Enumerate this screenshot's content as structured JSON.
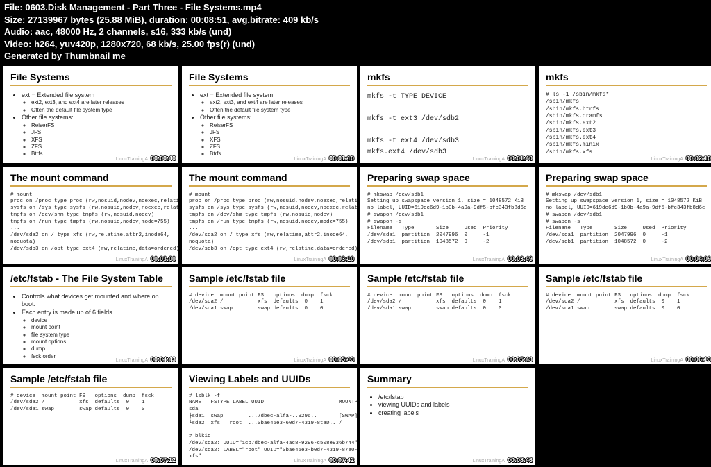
{
  "header": {
    "l1a": "File: ",
    "l1b": "0603.Disk Management - Part Three - File Systems.mp4",
    "l2": "Size: 27139967 bytes (25.88 MiB), duration: 00:08:51, avg.bitrate: 409 kb/s",
    "l3": "Audio: aac, 48000 Hz, 2 channels, s16, 333 kb/s (und)",
    "l4": "Video: h264, yuv420p, 1280x720, 68 kb/s, 25.00 fps(r) (und)",
    "l5": "Generated by Thumbnail me"
  },
  "brand": "LinuxTrainingA",
  "slides": [
    {
      "title": "File Systems",
      "ts": "00:00:40",
      "bullets": [
        {
          "text": "ext = Extended file system",
          "sub": [
            "ext2, ext3, and ext4 are later releases",
            "Often the default file system type"
          ]
        },
        {
          "text": "Other file systems:",
          "sub": [
            "ReiserFS",
            "JFS",
            "XFS",
            "ZFS",
            "Btrfs"
          ]
        }
      ]
    },
    {
      "title": "File Systems",
      "ts": "00:01:10",
      "bullets": [
        {
          "text": "ext = Extended file system",
          "sub": [
            "ext2, ext3, and ext4 are later releases",
            "Often the default file system type"
          ]
        },
        {
          "text": "Other file systems:",
          "sub": [
            "ReiserFS",
            "JFS",
            "XFS",
            "ZFS",
            "Btrfs"
          ]
        }
      ]
    },
    {
      "title": "mkfs",
      "ts": "00:01:40",
      "codeClass": "big",
      "code": "mkfs -t TYPE DEVICE\n\nmkfs -t ext3 /dev/sdb2\n\nmkfs -t ext4 /dev/sdb3\nmkfs.ext4 /dev/sdb3"
    },
    {
      "title": "mkfs",
      "ts": "00:02:10",
      "codeClass": "med",
      "code": "# ls -1 /sbin/mkfs*\n/sbin/mkfs\n/sbin/mkfs.btrfs\n/sbin/mkfs.cramfs\n/sbin/mkfs.ext2\n/sbin/mkfs.ext3\n/sbin/mkfs.ext4\n/sbin/mkfs.minix\n/sbin/mkfs.xfs"
    },
    {
      "title": "The mount command",
      "ts": "00:03:00",
      "code": "# mount\nproc on /proc type proc (rw,nosuid,nodev,noexec,relatime)\nsysfs on /sys type sysfs (rw,nosuid,nodev,noexec,relatime)\ntmpfs on /dev/shm type tmpfs (rw,nosuid,nodev)\ntmpfs on /run type tmpfs (rw,nosuid,nodev,mode=755)\n...\n/dev/sda2 on / type xfs (rw,relatime,attr2,inode64,\nnoquota)\n/dev/sdb3 on /opt type ext4 (rw,relatime,data=ordered)"
    },
    {
      "title": "The mount command",
      "ts": "00:03:10",
      "code": "# mount\nproc on /proc type proc (rw,nosuid,nodev,noexec,relatime)\nsysfs on /sys type sysfs (rw,nosuid,nodev,noexec,relatime)\ntmpfs on /dev/shm type tmpfs (rw,nosuid,nodev)\ntmpfs on /run type tmpfs (rw,nosuid,nodev,mode=755)\n...\n/dev/sda2 on / type xfs (rw,relatime,attr2,inode64,\nnoquota)\n/dev/sdb3 on /opt type ext4 (rw,relatime,data=ordered)"
    },
    {
      "title": "Preparing swap space",
      "ts": "00:03:49",
      "code": "# mkswap /dev/sdb1\nSetting up swapspace version 1, size = 1048572 KiB\nno label, UUID=619dc6d9-1b0b-4a9a-9df5-bfc343fb8d6e\n# swapon /dev/sdb1\n# swapon -s\nFilename   Type       Size     Used  Priority\n/dev/sda1  partition  2047996  0     -1\n/dev/sdb1  partition  1048572  0     -2"
    },
    {
      "title": "Preparing swap space",
      "ts": "00:04:09",
      "code": "# mkswap /dev/sdb1\nSetting up swapspace version 1, size = 1048572 KiB\nno label, UUID=619dc6d9-1b0b-4a9a-9df5-bfc343fb8d6e\n# swapon /dev/sdb1\n# swapon -s\nFilename   Type       Size     Used  Priority\n/dev/sda1  partition  2047996  0     -1\n/dev/sdb1  partition  1048572  0     -2"
    },
    {
      "title": "/etc/fstab - The File System Table",
      "ts": "00:04:43",
      "bullets": [
        {
          "text": "Controls what devices get mounted and where on boot."
        },
        {
          "text": "Each entry is made up of 6 fields",
          "sub": [
            "device",
            "mount point",
            "file system type",
            "mount options",
            "dump",
            "fsck order"
          ]
        }
      ]
    },
    {
      "title": "Sample /etc/fstab file",
      "ts": "00:05:13",
      "code": "# device  mount point FS   options  dump  fsck\n/dev/sda2 /           xfs  defaults  0    1\n/dev/sda1 swap        swap defaults  0    0"
    },
    {
      "title": "Sample /etc/fstab file",
      "ts": "00:05:43",
      "code": "# device  mount point FS   options  dump  fsck\n/dev/sda2 /           xfs  defaults  0    1\n/dev/sda1 swap        swap defaults  0    0"
    },
    {
      "title": "Sample /etc/fstab file",
      "ts": "00:06:13",
      "code": "# device  mount point FS   options  dump  fsck\n/dev/sda2 /           xfs  defaults  0    1\n/dev/sda1 swap        swap defaults  0    0"
    },
    {
      "title": "Sample /etc/fstab file",
      "ts": "00:07:12",
      "code": "# device  mount point FS   options  dump  fsck\n/dev/sda2 /           xfs  defaults  0    1\n/dev/sda1 swap        swap defaults  0    0"
    },
    {
      "title": "Viewing Labels and UUIDs",
      "ts": "00:07:42",
      "code": "# lsblk -f\nNAME   FSTYPE LABEL UUID                        MOUNTPOINT\nsda\n├sda1  swap        ...7dbec-alfa-..9296..       [SWAP]\n└sda2  xfs   root  ...0bae45e3-60d7-4319-8taD.. /\n\n# blkid\n/dev/sda2: UUID=\"1cb7dbec-alfa-4ac8-9296-c508e936b744\" TYPE=\"swap\"\n/dev/sda2: LABEL=\"root\" UUID=\"0bae45e3-b0d7-4319-87e0-b93aaab103f7\" TYPE=\"\nxfs\""
    },
    {
      "title": "Summary",
      "ts": "00:08:46",
      "bullets": [
        {
          "text": "/etc/fstab"
        },
        {
          "text": "viewing UUIDs and labels"
        },
        {
          "text": "creating labels"
        }
      ]
    }
  ]
}
